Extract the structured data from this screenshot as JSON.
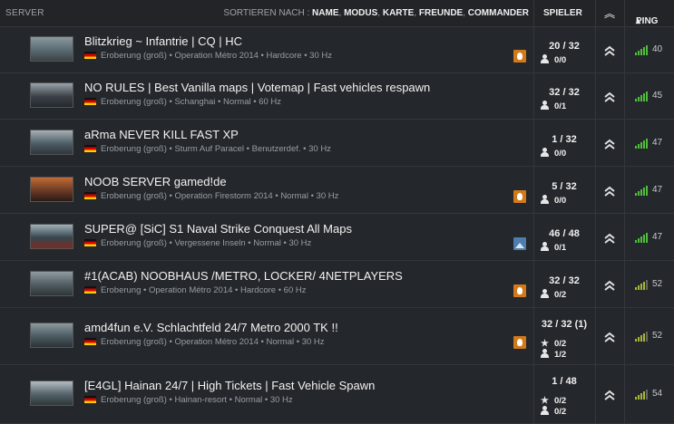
{
  "header": {
    "server": "SERVER",
    "sort_prefix": "SORTIEREN NACH :",
    "sort_options": [
      "NAME",
      "MODUS",
      "KARTE",
      "FREUNDE",
      "COMMANDER"
    ],
    "spieler": "SPIELER",
    "rank_icon": "chevron-up-double-icon",
    "ping": "PING",
    "ping_sort_icon": "caret-up-icon"
  },
  "colors": {
    "ping_good": "#4fbf3a",
    "ping_ok": "#a8b832",
    "mode_flame": "#d27a1a",
    "mode_pic": "#4e7eb0"
  },
  "servers": [
    {
      "name": "Blitzkrieg ~ Infantrie | CQ | HC",
      "meta": "Eroberung (groß) • Operation Métro 2014 • Hardcore • 30 Hz",
      "mode_icon": "flame-icon",
      "players": "20 / 32",
      "queue": "0/0",
      "commander": null,
      "ping": "40",
      "ping_quality": "good"
    },
    {
      "name": "NO RULES | Best Vanilla maps | Votemap | Fast vehicles respawn",
      "meta": "Eroberung (groß) • Schanghai • Normal • 60 Hz",
      "mode_icon": null,
      "players": "32 / 32",
      "queue": "0/1",
      "commander": null,
      "ping": "45",
      "ping_quality": "good"
    },
    {
      "name": "aRma NEVER KILL FAST XP",
      "meta": "Eroberung (groß) • Sturm Auf Paracel • Benutzerdef. • 30 Hz",
      "mode_icon": null,
      "players": "1 / 32",
      "queue": "0/0",
      "commander": null,
      "ping": "47",
      "ping_quality": "good"
    },
    {
      "name": "NOOB SERVER gamed!de",
      "meta": "Eroberung (groß) • Operation Firestorm 2014 • Normal • 30 Hz",
      "mode_icon": "flame-icon",
      "players": "5 / 32",
      "queue": "0/0",
      "commander": null,
      "ping": "47",
      "ping_quality": "good"
    },
    {
      "name": "SUPER@ [SiC] S1 Naval Strike Conquest All Maps",
      "meta": "Eroberung (groß) • Vergessene Inseln • Normal • 30 Hz",
      "mode_icon": "picture-icon",
      "players": "46 / 48",
      "queue": "0/1",
      "commander": null,
      "ping": "47",
      "ping_quality": "good"
    },
    {
      "name": "#1(ACAB) NOOBHAUS /METRO, LOCKER/ 4NETPLAYERS",
      "meta": "Eroberung • Operation Métro 2014 • Hardcore • 60 Hz",
      "mode_icon": "flame-icon",
      "players": "32 / 32",
      "queue": "0/2",
      "commander": null,
      "ping": "52",
      "ping_quality": "ok"
    },
    {
      "name": "amd4fun e.V. Schlachtfeld 24/7 Metro 2000 TK !!",
      "meta": "Eroberung (groß) • Operation Métro 2014 • Normal • 30 Hz",
      "mode_icon": "flame-icon",
      "players": "32 / 32 (1)",
      "queue": "1/2",
      "commander": "0/2",
      "ping": "52",
      "ping_quality": "ok"
    },
    {
      "name": "[E4GL] Hainan 24/7 | High Tickets | Fast Vehicle Spawn",
      "meta": "Eroberung (groß) • Hainan-resort • Normal • 30 Hz",
      "mode_icon": null,
      "players": "1 / 48",
      "queue": "0/2",
      "commander": "0/2",
      "ping": "54",
      "ping_quality": "ok"
    }
  ]
}
